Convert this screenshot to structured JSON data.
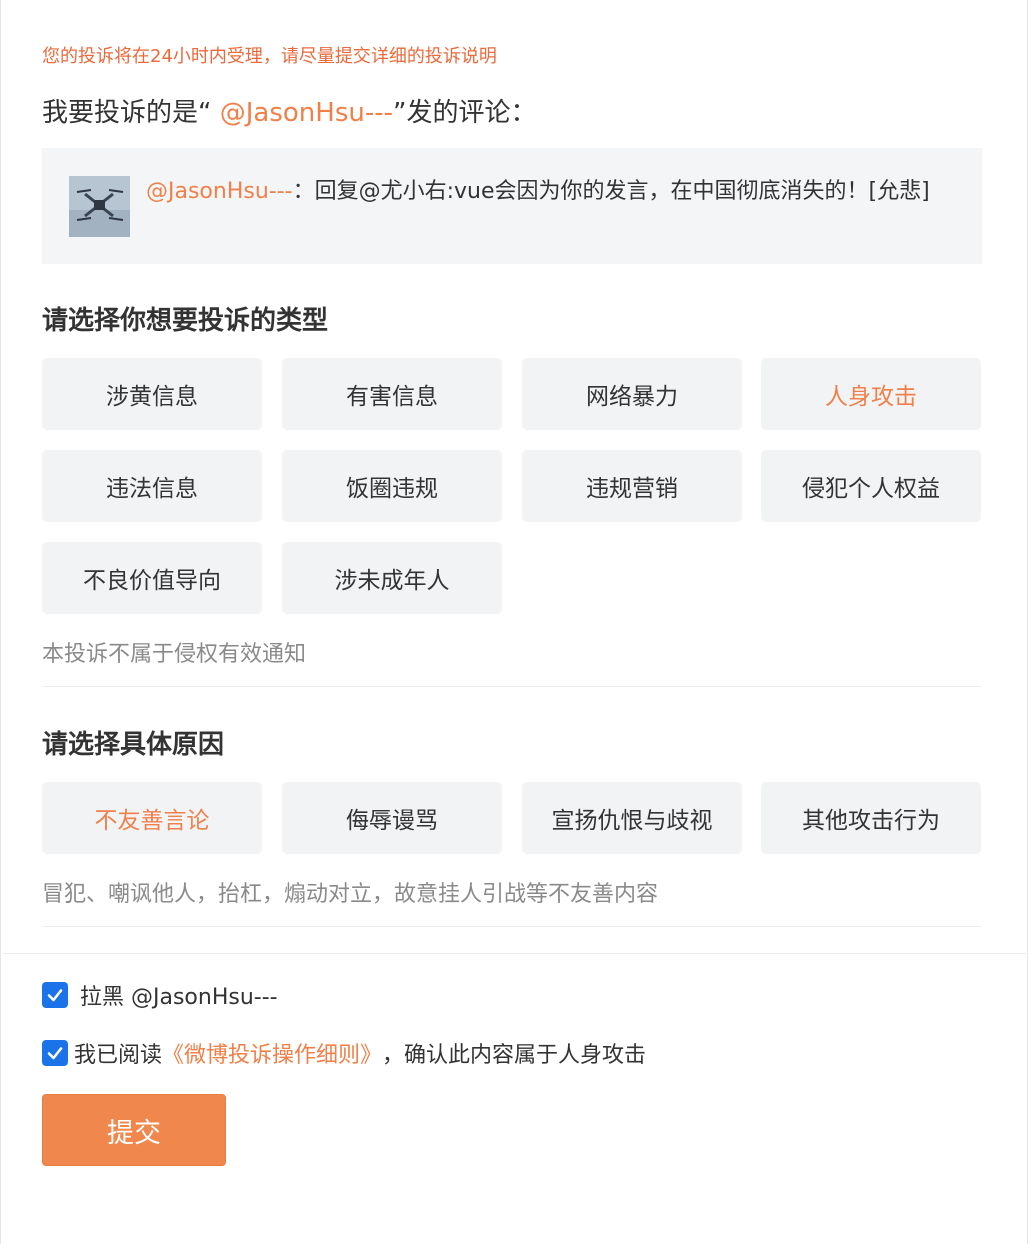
{
  "notice": "您的投诉将在24小时内受理，请尽量提交详细的投诉说明",
  "target": {
    "prefix": "我要投诉的是“",
    "user": " @JasonHsu---",
    "suffix": "”发的评论："
  },
  "comment": {
    "author": "@JasonHsu---",
    "separator": "：",
    "text": "回复@尤小右:vue会因为你的发言，在中国彻底消失的！[允悲]"
  },
  "type_section": {
    "title": "请选择你想要投诉的类型",
    "options": [
      "涉黄信息",
      "有害信息",
      "网络暴力",
      "人身攻击",
      "违法信息",
      "饭圈违规",
      "违规营销",
      "侵犯个人权益",
      "不良价值导向",
      "涉未成年人"
    ],
    "selected": "人身攻击",
    "hint": "本投诉不属于侵权有效通知"
  },
  "reason_section": {
    "title": "请选择具体原因",
    "options": [
      "不友善言论",
      "侮辱谩骂",
      "宣扬仇恨与歧视",
      "其他攻击行为"
    ],
    "selected": "不友善言论",
    "hint": "冒犯、嘲讽他人，抬杠，煽动对立，故意挂人引战等不友善内容"
  },
  "block": {
    "checked": true,
    "label": "拉黑 @JasonHsu---"
  },
  "agree": {
    "checked": true,
    "prefix": "我已阅读",
    "link": "《微博投诉操作细则》",
    "suffix": "，确认此内容属于人身攻击"
  },
  "submit_label": "提交",
  "colors": {
    "accent": "#f0804a",
    "button": "#f0884e",
    "checkbox": "#1a73e8",
    "option_bg": "#f2f3f5"
  }
}
